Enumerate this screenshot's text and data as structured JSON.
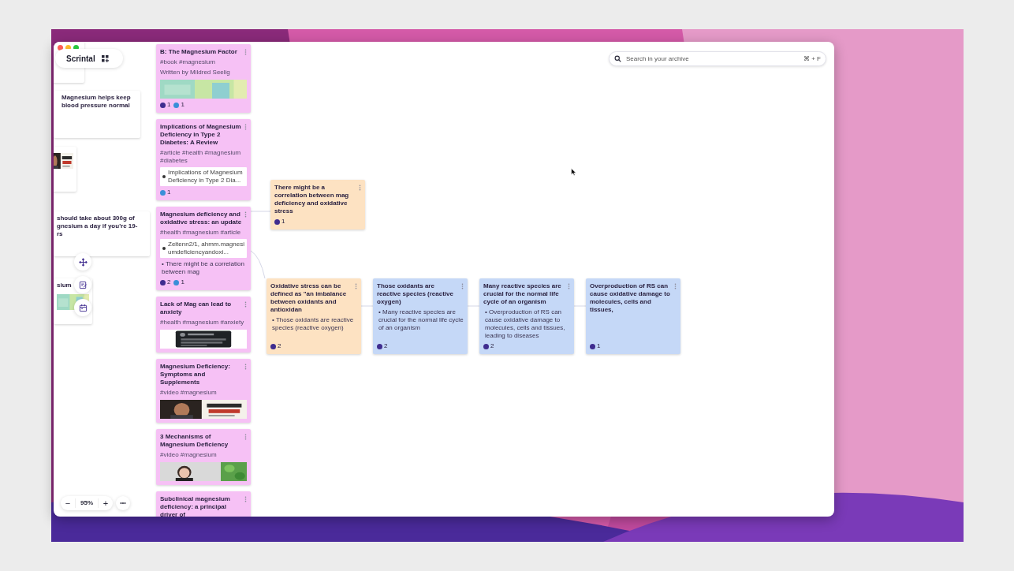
{
  "app": {
    "name": "Scrintal"
  },
  "search": {
    "placeholder": "Search in your archive",
    "shortcut": "⌘ + F"
  },
  "zoom": {
    "value": "95%",
    "minus": "−",
    "plus": "+",
    "more": "•••"
  },
  "edge_cards": [
    {
      "text": "Magnesium helps keep blood pressure normal"
    },
    {
      "picture": true
    },
    {
      "lines": [
        "should take about 300g of",
        "gnesium a day if you're 19-",
        "rs"
      ]
    },
    {
      "lines": [
        "sium"
      ],
      "picture": true
    }
  ],
  "cards": [
    {
      "color": "#f6c1f5",
      "title": "B: The Magnesium Factor",
      "tags": "#book #magnesium",
      "byline": "Written by Mildred Seelig",
      "picture": true,
      "badges": [
        {
          "color": "#3f2c8f",
          "count": "1"
        },
        {
          "color": "#3a8fd8",
          "count": "1"
        }
      ]
    },
    {
      "color": "#f6c1f5",
      "title": "Implications of Magnesium Deficiency in Type 2 Diabetes: A Review",
      "tags": "#article #health #magnesium #diabetes",
      "link": "Implications of Magnesium Deficiency in Type 2 Dia...",
      "badges": [
        {
          "color": "#3a8fd8",
          "count": "1"
        }
      ]
    },
    {
      "color": "#f6c1f5",
      "title": "Magnesium deficiency and oxidative stress: an update",
      "tags": "#health #magnesium #article",
      "link": "Zeitenn2/1, ahmm.magnesiumdeficiencyandoxi...",
      "quote": "• There might be a correlation between mag",
      "badges": [
        {
          "color": "#3f2c8f",
          "count": "2"
        },
        {
          "color": "#3a8fd8",
          "count": "1"
        }
      ]
    },
    {
      "color": "#f6c1f5",
      "title": "Lack of Mag can lead to anxiety",
      "tags": "#health #magnesium #anxiety",
      "picture": true
    },
    {
      "color": "#f6c1f5",
      "title": "Magnesium Deficiency: Symptoms and Supplements",
      "tags": "#video #magnesium",
      "picture": true
    },
    {
      "color": "#f6c1f5",
      "title": "3 Mechanisms of Magnesium Deficiency",
      "tags": "#video #magnesium",
      "picture": true
    },
    {
      "color": "#f6c1f5",
      "title": "Subclinical magnesium deficiency: a principal driver of"
    },
    {
      "color": "#fde2c2",
      "title": "There might be a correlation between mag deficiency and oxidative stress",
      "badges": [
        {
          "color": "#3f2c8f",
          "count": "1"
        }
      ]
    },
    {
      "color": "#fde2c2",
      "title": "Oxidative stress can be defined as \"an imbalance between oxidants and antioxidan",
      "quote": "• Those oxidants are reactive species (reactive oxygen)",
      "badges": [
        {
          "color": "#3f2c8f",
          "count": "2"
        }
      ]
    },
    {
      "color": "#c5d8f7",
      "title": "Those oxidants are reactive species (reactive oxygen)",
      "quote": "• Many reactive species are crucial for the normal life cycle of an organism",
      "badges": [
        {
          "color": "#3f2c8f",
          "count": "2"
        }
      ]
    },
    {
      "color": "#c5d8f7",
      "title": "Many reactive species are crucial for the normal life cycle of an organism",
      "quote": "• Overproduction of RS can cause oxidative damage to molecules, cells and tissues, leading to diseases",
      "badges": [
        {
          "color": "#3f2c8f",
          "count": "2"
        }
      ]
    },
    {
      "color": "#c5d8f7",
      "title": "Overproduction of RS can cause oxidative damage to molecules, cells and tissues,",
      "badges": [
        {
          "color": "#3f2c8f",
          "count": "1"
        }
      ]
    }
  ]
}
